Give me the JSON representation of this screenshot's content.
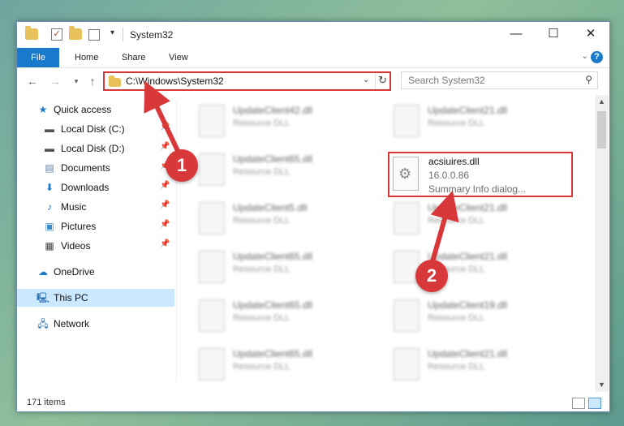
{
  "window": {
    "title": "System32",
    "controls": {
      "minimize": "—",
      "maximize": "☐",
      "close": "✕"
    }
  },
  "ribbon": {
    "tabs": [
      {
        "label": "File"
      },
      {
        "label": "Home"
      },
      {
        "label": "Share"
      },
      {
        "label": "View"
      }
    ],
    "help_label": "?"
  },
  "nav": {
    "address": "C:\\Windows\\System32",
    "search_placeholder": "Search System32"
  },
  "sidebar": {
    "items": [
      {
        "label": "Quick access",
        "icon": "star-icon",
        "pinned": false
      },
      {
        "label": "Local Disk (C:)",
        "icon": "drive-icon",
        "pinned": true
      },
      {
        "label": "Local Disk (D:)",
        "icon": "drive-icon",
        "pinned": true
      },
      {
        "label": "Documents",
        "icon": "documents-icon",
        "pinned": true
      },
      {
        "label": "Downloads",
        "icon": "download-icon",
        "pinned": true
      },
      {
        "label": "Music",
        "icon": "music-icon",
        "pinned": true
      },
      {
        "label": "Pictures",
        "icon": "pictures-icon",
        "pinned": true
      },
      {
        "label": "Videos",
        "icon": "videos-icon",
        "pinned": true
      },
      {
        "label": "OneDrive",
        "icon": "cloud-icon",
        "pinned": false
      },
      {
        "label": "This PC",
        "icon": "computer-icon",
        "pinned": false,
        "selected": true
      },
      {
        "label": "Network",
        "icon": "network-icon",
        "pinned": false
      }
    ]
  },
  "files": {
    "left_column": [
      {
        "name": "UpdateClient42.dll",
        "type": "Resource DLL"
      },
      {
        "name": "UpdateClient65.dll",
        "type": "Resource DLL"
      },
      {
        "name": "UpdateClient5.dll",
        "type": "Resource DLL"
      },
      {
        "name": "UpdateClient65.dll",
        "type": "Resource DLL"
      },
      {
        "name": "UpdateClient65.dll",
        "type": "Resource DLL"
      },
      {
        "name": "UpdateClient65.dll",
        "type": "Resource DLL"
      }
    ],
    "right_column": [
      {
        "name": "UpdateClient21.dll",
        "type": "Resource DLL"
      },
      {
        "name": "UpdateClient21.dll",
        "type": "Resource DLL"
      },
      {
        "name": "UpdateClient21.dll",
        "type": "Resource DLL"
      },
      {
        "name": "UpdateClient19.dll",
        "type": "Resource DLL"
      },
      {
        "name": "UpdateClient21.dll",
        "type": "Resource DLL"
      }
    ],
    "highlighted": {
      "name": "acsiuires.dll",
      "version": "16.0.0.86",
      "description": "Summary Info dialog..."
    }
  },
  "status": {
    "item_count": "171 items"
  },
  "annotations": [
    {
      "label": "1"
    },
    {
      "label": "2"
    }
  ],
  "colors": {
    "accent": "#1979ca",
    "highlight": "#d9383a",
    "selection": "#cce8ff"
  }
}
